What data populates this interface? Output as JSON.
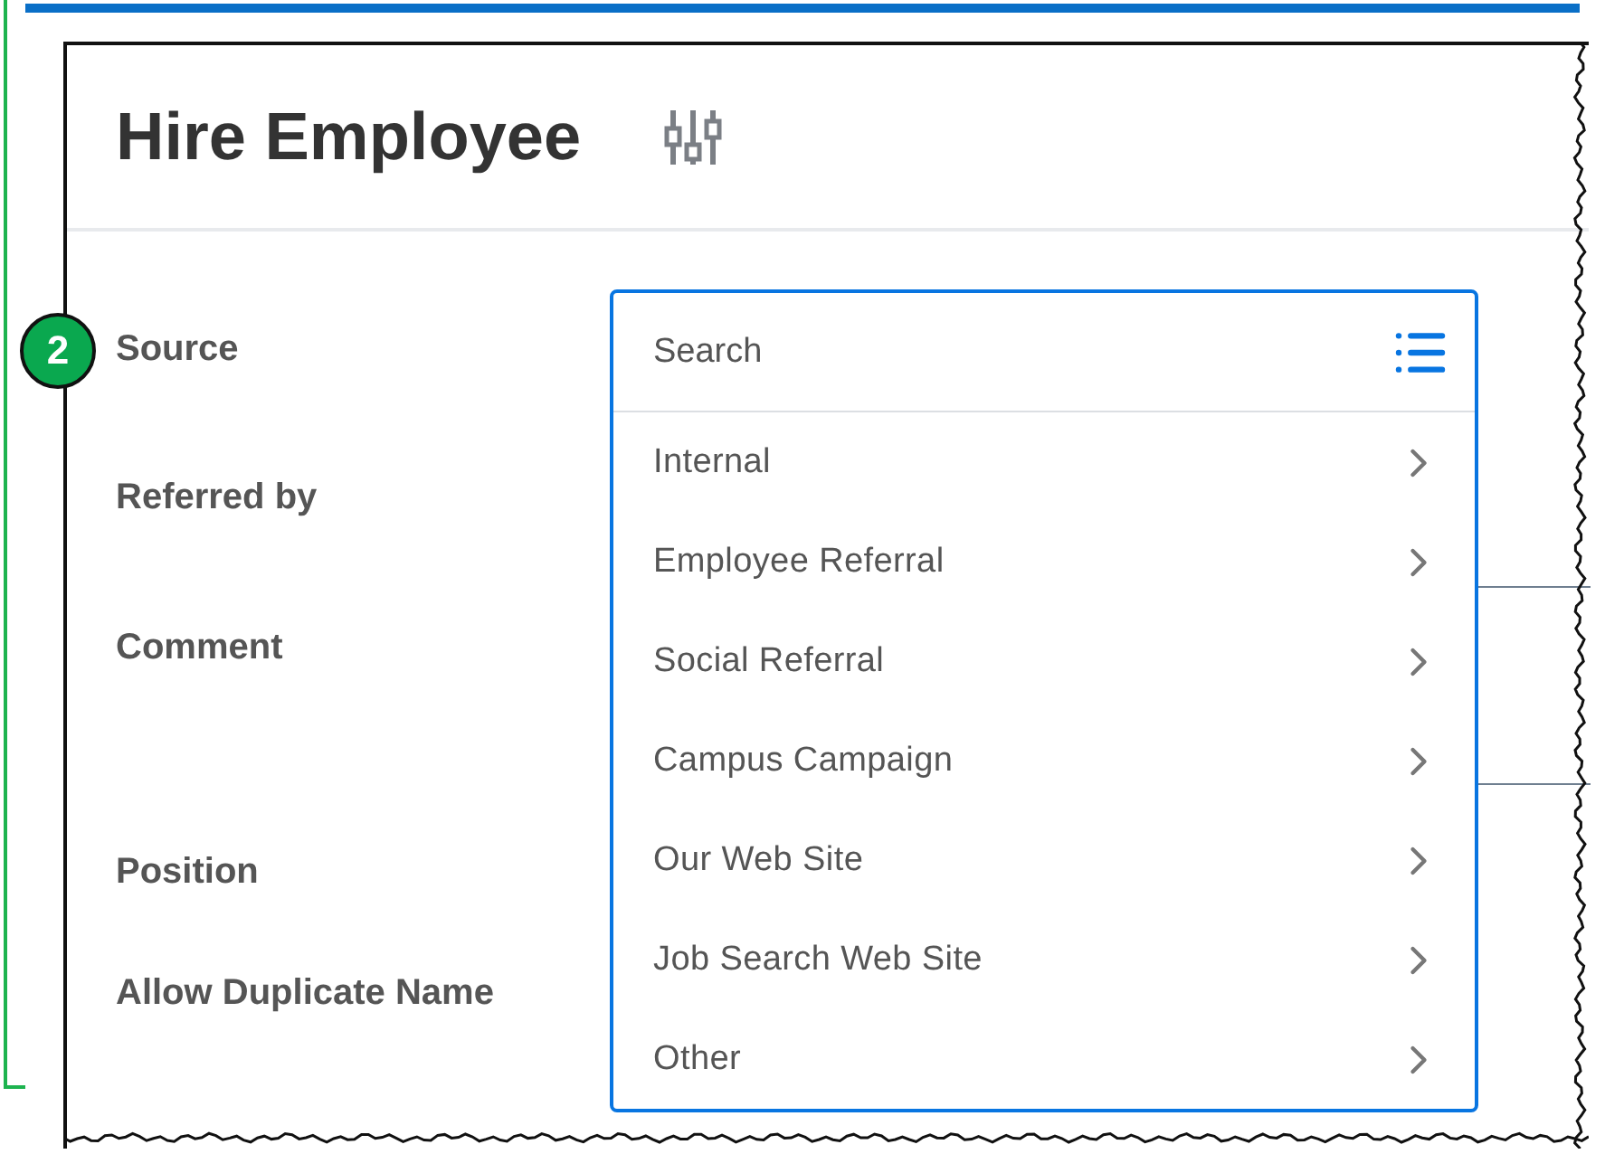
{
  "page": {
    "title": "Hire Employee"
  },
  "step_badge": "2",
  "fields": [
    {
      "label": "Source"
    },
    {
      "label": "Referred by"
    },
    {
      "label": "Comment"
    },
    {
      "label": "Position"
    },
    {
      "label": "Allow Duplicate Name"
    }
  ],
  "dropdown": {
    "placeholder": "Search",
    "options": [
      {
        "label": "Internal"
      },
      {
        "label": "Employee Referral"
      },
      {
        "label": "Social Referral"
      },
      {
        "label": "Campus Campaign"
      },
      {
        "label": "Our Web Site"
      },
      {
        "label": "Job Search Web Site"
      },
      {
        "label": "Other"
      }
    ]
  }
}
